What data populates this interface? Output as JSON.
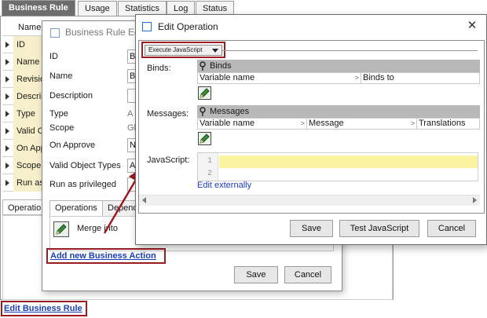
{
  "main_tabs": [
    "Business Rule",
    "Usage",
    "Statistics",
    "Log",
    "Status"
  ],
  "bg_table": {
    "header": "Name",
    "rows": [
      "ID",
      "Name",
      "Revisio",
      "Descrip",
      "Type",
      "Valid O",
      "On App",
      "Scope",
      "Run as"
    ]
  },
  "bg_lower_tab": "Operatio",
  "edit_business_rule": "Edit Business Rule",
  "middle_dialog": {
    "title": "Business Rule Edi",
    "labels": [
      "ID",
      "Name",
      "Description",
      "Type",
      "Scope",
      "On Approve",
      "Valid Object Types",
      "Run as privileged"
    ],
    "partial_values": [
      "B",
      "B",
      "",
      "A",
      "Gl",
      "N",
      "A",
      ""
    ],
    "tabs": [
      "Operations",
      "Depend"
    ],
    "operation_label": "Merge  into",
    "add_action_link": "Add new Business Action",
    "save_label": "Save",
    "cancel_label": "Cancel"
  },
  "edit_operation": {
    "title": "Edit Operation",
    "close_glyph": "✕",
    "operation_type": "Execute JavaScript",
    "binds_label": "Binds:",
    "binds_grid_title": "Binds",
    "binds_columns": [
      "Variable name",
      "Binds to"
    ],
    "messages_label": "Messages:",
    "messages_grid_title": "Messages",
    "messages_columns": [
      "Variable name",
      "Message",
      "Translations"
    ],
    "javascript_label": "JavaScript:",
    "line_numbers": [
      "1",
      "2"
    ],
    "edit_externally": "Edit externally",
    "save_label": "Save",
    "test_label": "Test JavaScript",
    "cancel_label": "Cancel"
  },
  "colors": {
    "highlight": "#9b1c23",
    "link": "#1a3fb7",
    "code_line": "#fbf3a0",
    "grid_header": "#b8b8b8"
  }
}
